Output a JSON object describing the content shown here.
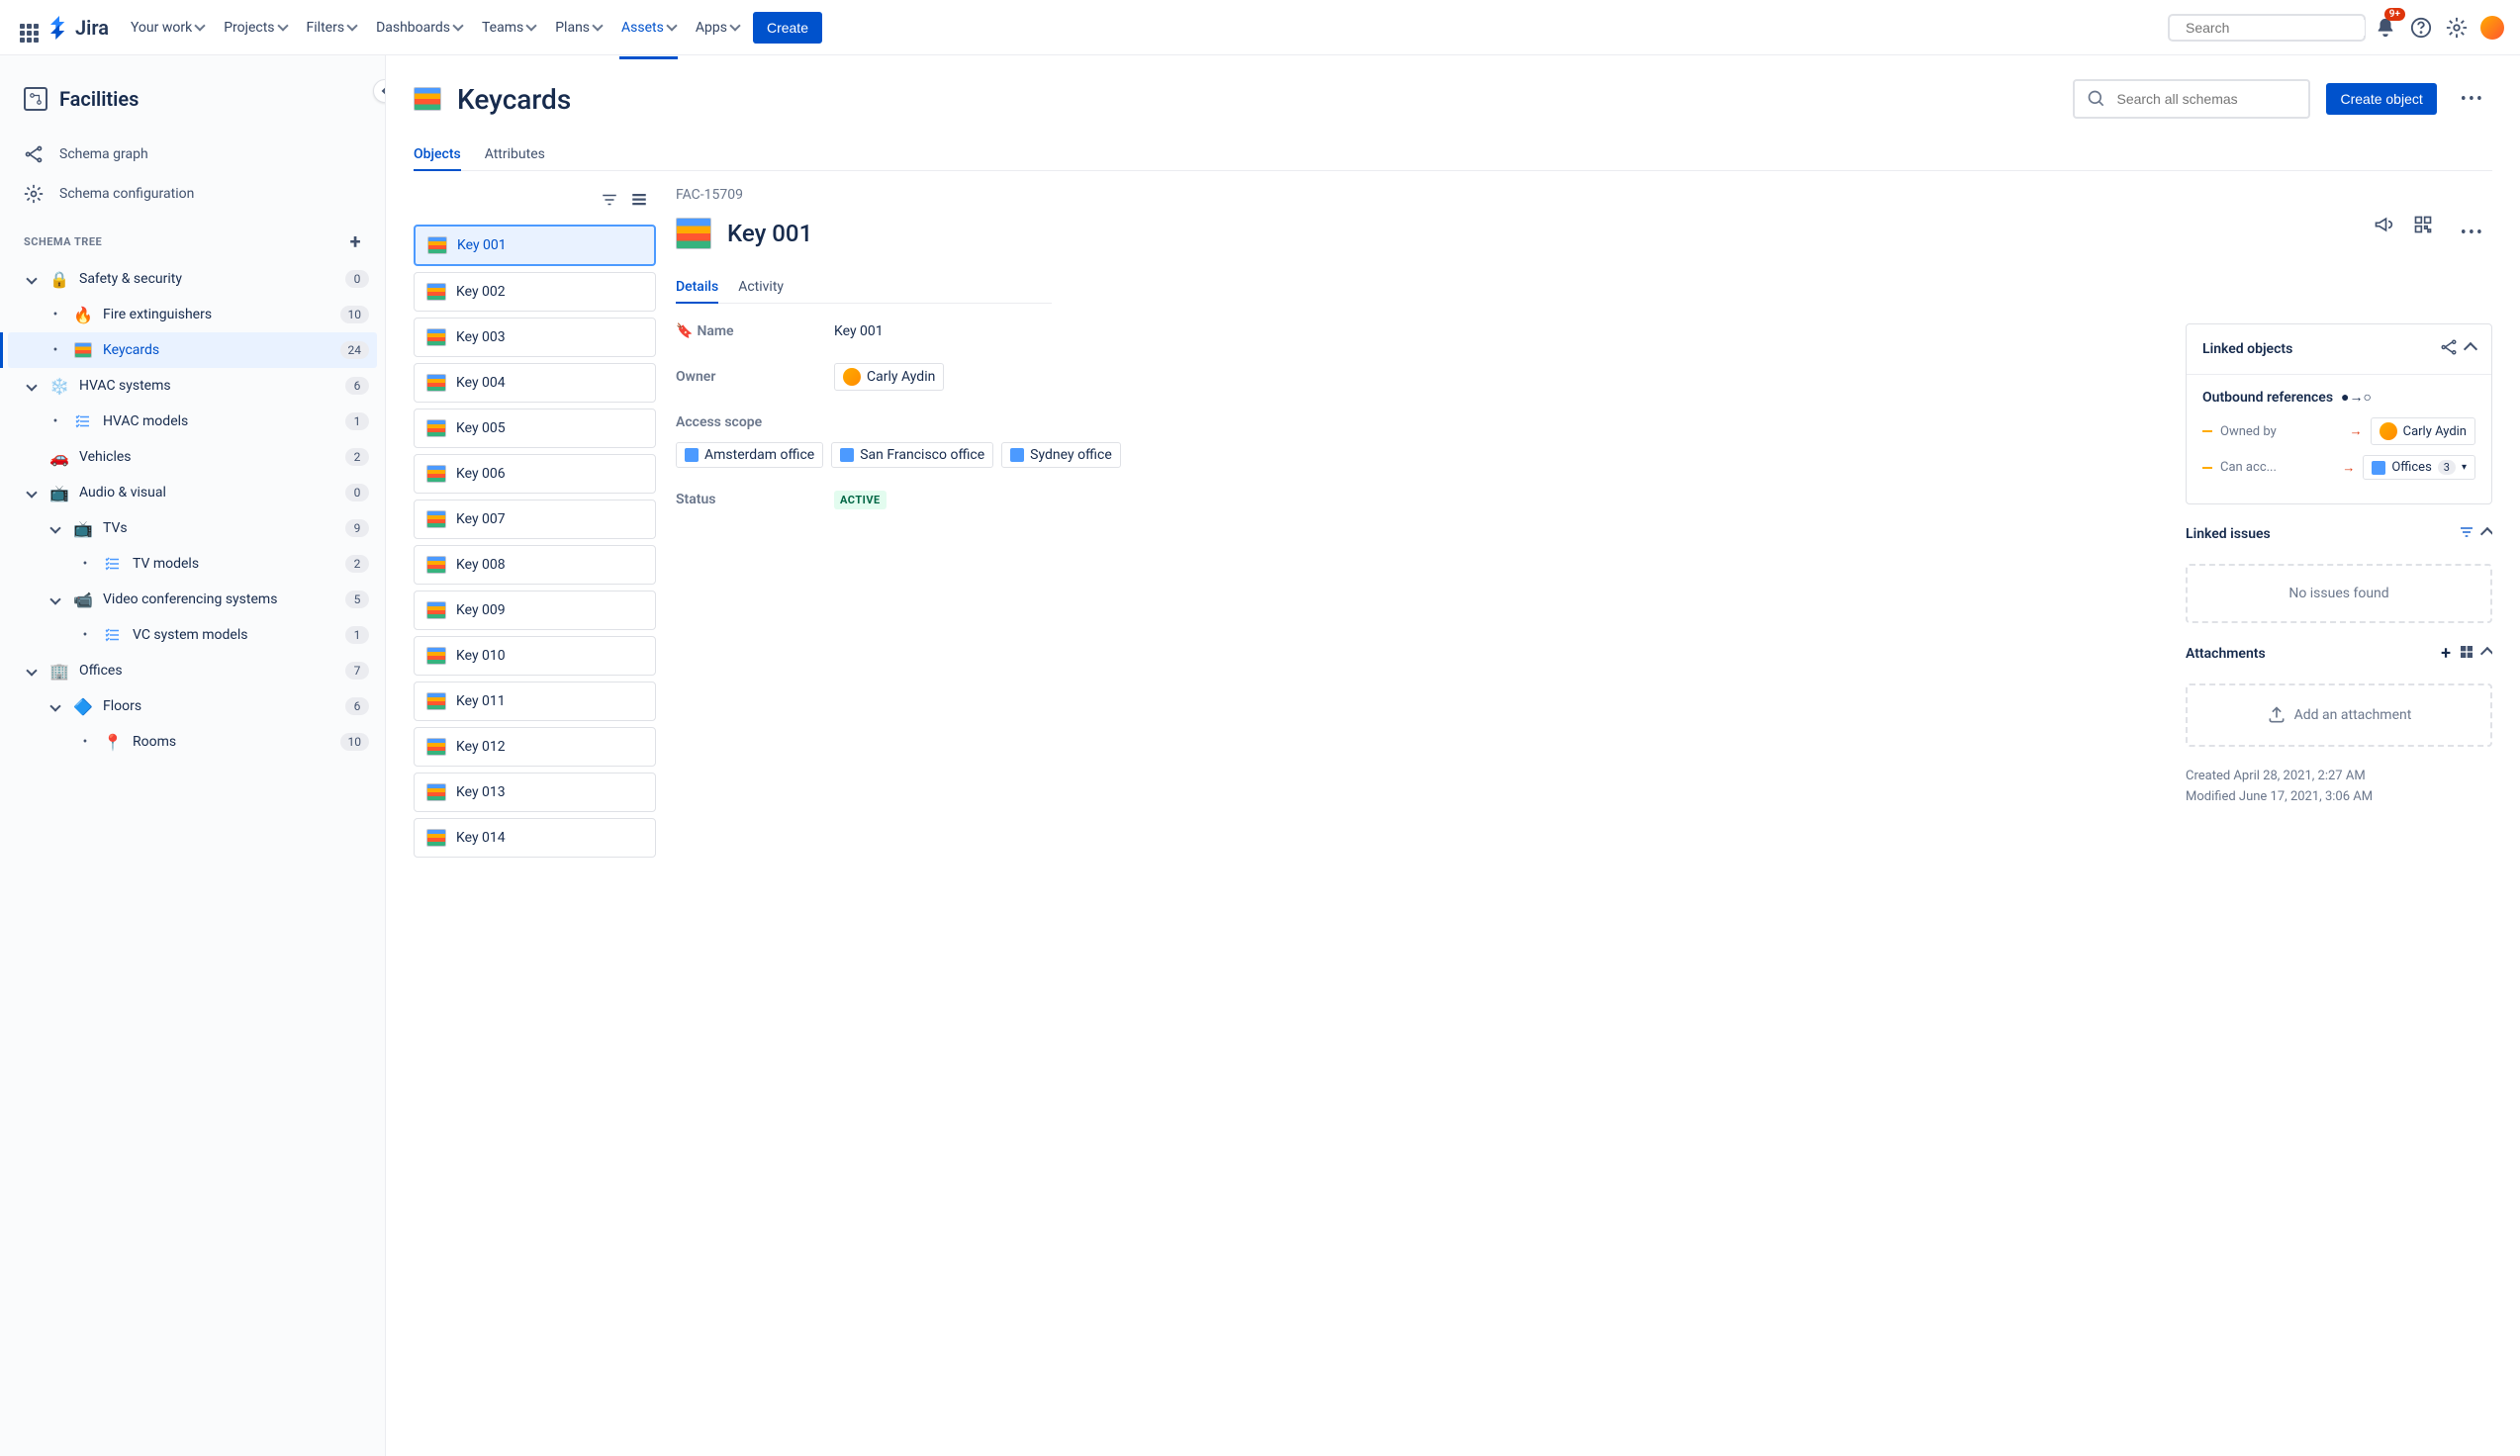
{
  "topnav": {
    "logo": "Jira",
    "items": [
      "Your work",
      "Projects",
      "Filters",
      "Dashboards",
      "Teams",
      "Plans",
      "Assets",
      "Apps"
    ],
    "active_item": "Assets",
    "create": "Create",
    "search_placeholder": "Search",
    "notification_badge": "9+"
  },
  "sidebar": {
    "title": "Facilities",
    "links": [
      {
        "label": "Schema graph"
      },
      {
        "label": "Schema configuration"
      }
    ],
    "section_label": "SCHEMA TREE",
    "tree": [
      {
        "label": "Safety & security",
        "icon": "🔒",
        "count": "0",
        "depth": 0,
        "expand": true
      },
      {
        "label": "Fire extinguishers",
        "icon": "🔥",
        "count": "10",
        "depth": 1,
        "bullet": true
      },
      {
        "label": "Keycards",
        "icon": "grid",
        "count": "24",
        "depth": 1,
        "bullet": true,
        "selected": true
      },
      {
        "label": "HVAC systems",
        "icon": "❄️",
        "count": "6",
        "depth": 0,
        "expand": true
      },
      {
        "label": "HVAC models",
        "icon": "list",
        "count": "1",
        "depth": 1,
        "bullet": true
      },
      {
        "label": "Vehicles",
        "icon": "🚗",
        "count": "2",
        "depth": 0
      },
      {
        "label": "Audio & visual",
        "icon": "📺",
        "count": "0",
        "depth": 0,
        "expand": true
      },
      {
        "label": "TVs",
        "icon": "📺",
        "count": "9",
        "depth": 1,
        "expand": true
      },
      {
        "label": "TV models",
        "icon": "list",
        "count": "2",
        "depth": 2,
        "bullet": true
      },
      {
        "label": "Video conferencing systems",
        "icon": "📹",
        "count": "5",
        "depth": 1,
        "expand": true
      },
      {
        "label": "VC system models",
        "icon": "list",
        "count": "1",
        "depth": 2,
        "bullet": true
      },
      {
        "label": "Offices",
        "icon": "🏢",
        "count": "7",
        "depth": 0,
        "expand": true
      },
      {
        "label": "Floors",
        "icon": "🔷",
        "count": "6",
        "depth": 1,
        "expand": true
      },
      {
        "label": "Rooms",
        "icon": "📍",
        "count": "10",
        "depth": 2,
        "bullet": true
      }
    ]
  },
  "page": {
    "title": "Keycards",
    "search_placeholder": "Search all schemas",
    "create_button": "Create object",
    "tabs": [
      "Objects",
      "Attributes"
    ],
    "active_tab": "Objects"
  },
  "key_list": [
    "Key 001",
    "Key 002",
    "Key 003",
    "Key 004",
    "Key 005",
    "Key 006",
    "Key 007",
    "Key 008",
    "Key 009",
    "Key 010",
    "Key 011",
    "Key 012",
    "Key 013",
    "Key 014"
  ],
  "selected_key": "Key 001",
  "detail": {
    "id": "FAC-15709",
    "title": "Key 001",
    "tabs": [
      "Details",
      "Activity"
    ],
    "active_tab": "Details",
    "fields": {
      "name_label": "Name",
      "name_value": "Key 001",
      "owner_label": "Owner",
      "owner_value": "Carly Aydin",
      "access_label": "Access scope",
      "access_values": [
        "Amsterdam office",
        "San Francisco office",
        "Sydney office"
      ],
      "status_label": "Status",
      "status_value": "ACTIVE"
    }
  },
  "side_panel": {
    "linked_objects_title": "Linked objects",
    "outbound_label": "Outbound references",
    "refs": [
      {
        "label": "Owned by",
        "target": "Carly Aydin",
        "type": "user"
      },
      {
        "label": "Can acc...",
        "target": "Offices",
        "count": "3",
        "type": "office"
      }
    ],
    "linked_issues_title": "Linked issues",
    "no_issues": "No issues found",
    "attachments_title": "Attachments",
    "add_attachment": "Add an attachment",
    "created": "Created April 28, 2021, 2:27 AM",
    "modified": "Modified June 17, 2021, 3:06 AM"
  }
}
